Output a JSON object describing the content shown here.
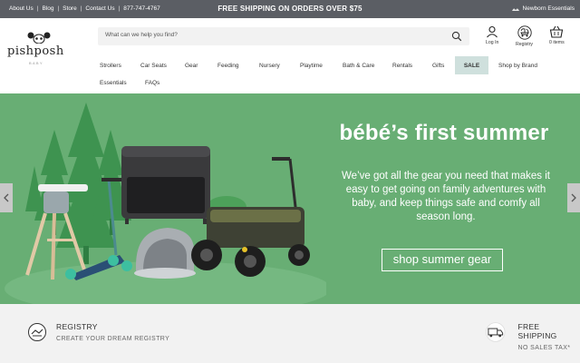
{
  "topbar": {
    "links": [
      "About Us",
      "Blog",
      "Store",
      "Contact Us",
      "877-747-4767"
    ],
    "separator": "|",
    "promo": "FREE SHIPPING ON ORDERS OVER $75",
    "newborn_label": "Newborn Essentials"
  },
  "header": {
    "logo_text": "pishposh",
    "logo_subtext": "BABY",
    "search_placeholder": "What can we help you find?",
    "login_label": "Log In",
    "registry_label": "Registry",
    "cart_label": "0 items"
  },
  "nav": {
    "items": [
      "Strollers",
      "Car Seats",
      "Gear",
      "Feeding",
      "Nursery",
      "Playtime",
      "Bath & Care",
      "Rentals",
      "Gifts",
      "SALE",
      "Shop by Brand"
    ],
    "row2": [
      "Essentials",
      "FAQs"
    ]
  },
  "hero": {
    "title": "bébé’s first summer",
    "body": "We’ve got all the gear you need that makes it easy to get going on family adventures with baby, and keep things safe and comfy all season long.",
    "cta": "shop summer gear"
  },
  "features": [
    {
      "title": "REGISTRY",
      "subtitle": "CREATE YOUR DREAM REGISTRY",
      "icon": "registry-icon"
    },
    {
      "title": "FREE SHIPPING",
      "subtitle": "NO SALES TAX*",
      "icon": "truck-icon"
    }
  ],
  "colors": {
    "topbar": "#5b5e64",
    "hero": "#68ae74",
    "sale_highlight": "#cfe0dd",
    "strip": "#f2f2f2"
  }
}
